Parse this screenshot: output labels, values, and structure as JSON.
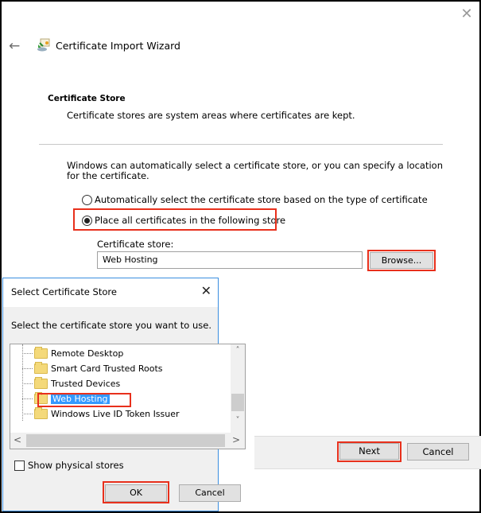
{
  "wizard": {
    "title": "Certificate Import Wizard",
    "close_glyph": "✕",
    "back_glyph": "←",
    "section_title": "Certificate Store",
    "section_desc": "Certificate stores are system areas where certificates are kept.",
    "intro": "Windows can automatically select a certificate store, or you can specify a location for the certificate.",
    "options": [
      {
        "label": "Automatically select the certificate store based on the type of certificate",
        "checked": false
      },
      {
        "label": "Place all certificates in the following store",
        "checked": true
      }
    ],
    "store_label": "Certificate store:",
    "store_value": "Web Hosting",
    "browse_label": "Browse...",
    "next_label": "Next",
    "cancel_label": "Cancel"
  },
  "dialog": {
    "title": "Select Certificate Store",
    "close_glyph": "✕",
    "prompt": "Select the certificate store you want to use.",
    "tree_items": [
      {
        "label": "Remote Desktop",
        "selected": false
      },
      {
        "label": "Smart Card Trusted Roots",
        "selected": false
      },
      {
        "label": "Trusted Devices",
        "selected": false
      },
      {
        "label": "Web Hosting",
        "selected": true
      },
      {
        "label": "Windows Live ID Token Issuer",
        "selected": false
      }
    ],
    "scroll": {
      "up": "˄",
      "down": "˅",
      "left": "<",
      "right": ">"
    },
    "show_physical_label": "Show physical stores",
    "show_physical_checked": false,
    "ok_label": "OK",
    "cancel_label": "Cancel"
  },
  "colors": {
    "highlight": "#e8301c",
    "selection": "#3399ff",
    "dialog_border": "#3a8ee0"
  }
}
